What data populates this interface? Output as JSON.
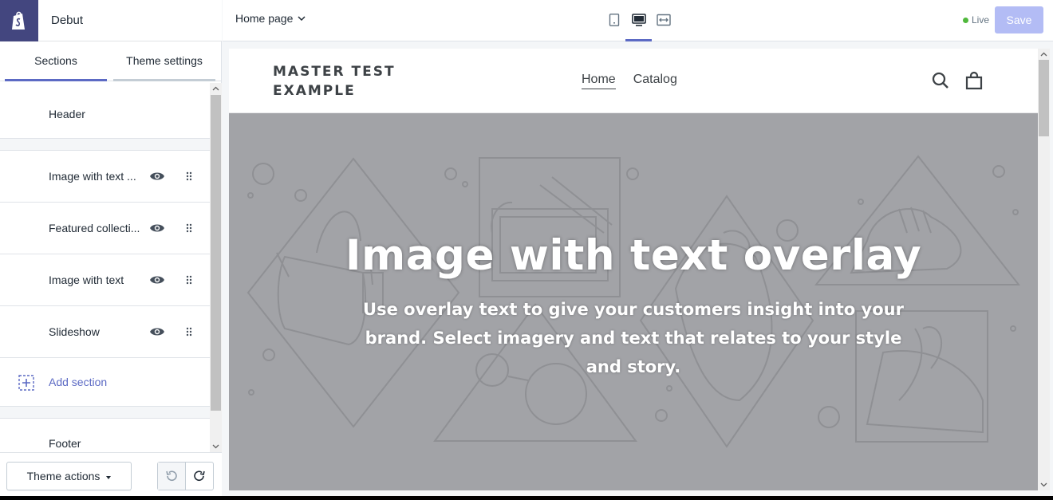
{
  "sidebar": {
    "theme_name": "Debut",
    "tabs": [
      {
        "label": "Sections"
      },
      {
        "label": "Theme settings"
      }
    ],
    "header_label": "Header",
    "sections": [
      {
        "label": "Image with text ..."
      },
      {
        "label": "Featured collecti..."
      },
      {
        "label": "Image with text"
      },
      {
        "label": "Slideshow"
      }
    ],
    "add_section_label": "Add section",
    "footer_label": "Footer",
    "theme_actions_label": "Theme actions"
  },
  "topbar": {
    "page_select": "Home page",
    "live_label": "Live",
    "save_label": "Save",
    "devices": [
      "mobile-icon",
      "desktop-icon",
      "full-width-icon"
    ]
  },
  "preview": {
    "store_name": "MASTER TEST EXAMPLE",
    "nav": [
      {
        "label": "Home"
      },
      {
        "label": "Catalog"
      }
    ],
    "hero": {
      "title": "Image with text overlay",
      "text": "Use overlay text to give your customers insight into your brand. Select imagery and text that relates to your style and story."
    }
  },
  "colors": {
    "accent": "#5c6ac4",
    "logo_bg": "#43467f",
    "save_disabled": "#b3bcf5",
    "live_dot": "#50b83c",
    "hero_bg": "#a2a3a7"
  }
}
